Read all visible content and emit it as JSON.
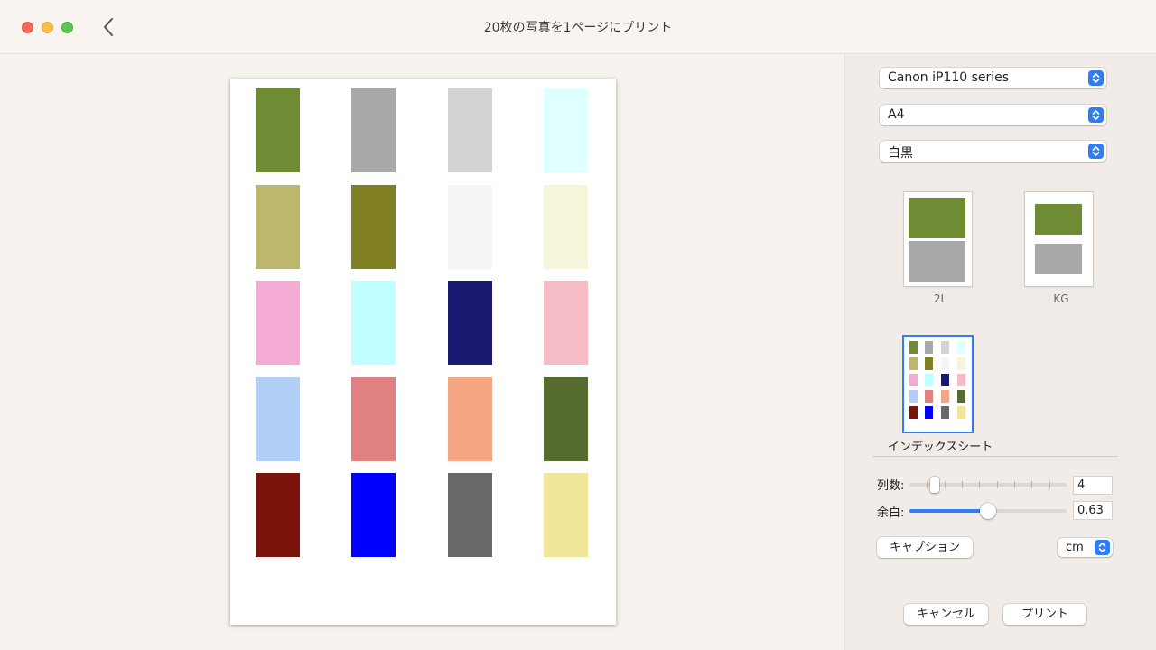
{
  "window": {
    "title": "20枚の写真を1ページにプリント"
  },
  "preview": {
    "photo_colors": [
      [
        "#6f8b33",
        "#a9a9a9",
        "#d3d3d3",
        "#e0ffff"
      ],
      [
        "#bdb76b",
        "#808022",
        "#f5f5f5",
        "#f5f5dc"
      ],
      [
        "#f4acd4",
        "#bfffff",
        "#191970",
        "#f5bcc6"
      ],
      [
        "#b0d0f8",
        "#e08080",
        "#f4a683",
        "#556b2f"
      ],
      [
        "#7a140a",
        "#0000ff",
        "#696969",
        "#f0e69a"
      ]
    ]
  },
  "sidebar": {
    "printer": "Canon iP110 series",
    "paper_size": "A4",
    "color_mode": "白黒",
    "layouts": [
      {
        "label": "2L",
        "colors": [
          "#6f8b33",
          "#a9a9a9"
        ]
      },
      {
        "label": "KG",
        "colors": [
          "#6f8b33",
          "#a9a9a9"
        ]
      },
      {
        "label": "インデックスシート"
      }
    ],
    "columns_label": "列数:",
    "columns_value": "4",
    "columns_max": 10,
    "margin_label": "余白:",
    "margin_value": "0.63",
    "margin_fraction": 0.5,
    "caption_button": "キャプション",
    "unit": "cm",
    "cancel_button": "キャンセル",
    "print_button": "プリント"
  }
}
